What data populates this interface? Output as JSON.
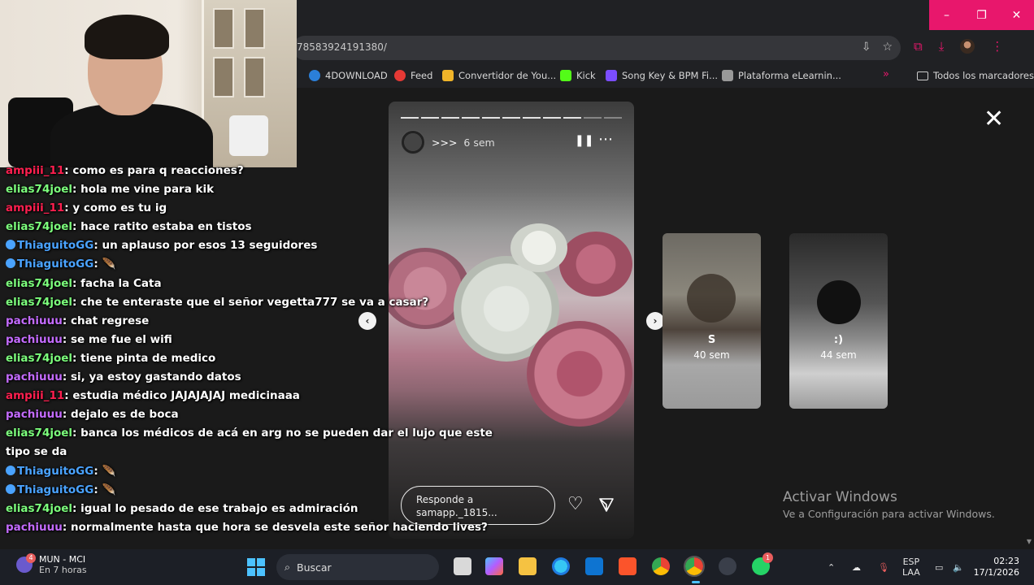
{
  "browser": {
    "url": "78583924191380/",
    "window_controls": {
      "minimize": "–",
      "maximize": "❐",
      "close": "✕"
    }
  },
  "bookmarks": [
    {
      "label": "4DOWNLOAD",
      "color": "#2b7fd9"
    },
    {
      "label": "Feed",
      "color": "#e53935"
    },
    {
      "label": "Convertidor de You...",
      "color": "#f0b429"
    },
    {
      "label": "Kick",
      "color": "#53fc18"
    },
    {
      "label": "Song Key & BPM Fi...",
      "color": "#7b4dff"
    },
    {
      "label": "Plataforma eLearnin...",
      "color": "#999999"
    }
  ],
  "bookmarks_overflow": "»",
  "bookmarks_all": "Todos los marcadores",
  "story": {
    "username": ">>>",
    "time": "6 sem",
    "pause_icon": "pause-icon",
    "more_icon": "⋯",
    "reply_placeholder": "Responde a samapp._1815...",
    "progress_segments": 11,
    "progress_viewed": 9
  },
  "side_stories": [
    {
      "initial": "S",
      "time": "40 sem"
    },
    {
      "initial": ":)",
      "time": "44 sem"
    }
  ],
  "close_label": "✕",
  "nav": {
    "prev": "‹",
    "next": "›"
  },
  "activate": {
    "title": "Activar Windows",
    "subtitle": "Ve a Configuración para activar Windows."
  },
  "chat": [
    {
      "user": "ampiii_11",
      "type": "ampiii",
      "msg": "como es para q reacciones?"
    },
    {
      "user": "elias74joel",
      "type": "elias",
      "msg": "hola me vine para kik"
    },
    {
      "user": "ampiii_11",
      "type": "ampiii",
      "msg": "y como es tu ig"
    },
    {
      "user": "elias74joel",
      "type": "elias",
      "msg": "hace ratito estaba en tistos"
    },
    {
      "user": "ThiaguitoGG",
      "type": "thiago",
      "msg": "un aplauso por esos 13 seguidores"
    },
    {
      "user": "ThiaguitoGG",
      "type": "thiago",
      "msg": "",
      "emote": true
    },
    {
      "user": "elias74joel",
      "type": "elias",
      "msg": "facha la Cata"
    },
    {
      "user": "elias74joel",
      "type": "elias",
      "msg": "che te enteraste que el señor vegetta777 se va a casar?"
    },
    {
      "user": "pachiuuu",
      "type": "pachi",
      "msg": "chat regrese"
    },
    {
      "user": "pachiuuu",
      "type": "pachi",
      "msg": "se me fue el wifi"
    },
    {
      "user": "elias74joel",
      "type": "elias",
      "msg": "tiene pinta de medico"
    },
    {
      "user": "pachiuuu",
      "type": "pachi",
      "msg": "si, ya estoy gastando datos"
    },
    {
      "user": "ampiii_11",
      "type": "ampiii",
      "msg": "estudia médico JAJAJAJAJ medicinaaa"
    },
    {
      "user": "pachiuuu",
      "type": "pachi",
      "msg": "dejalo es de boca"
    },
    {
      "user": "elias74joel",
      "type": "elias",
      "msg": "banca los médicos de acá en arg no se pueden dar el lujo que este"
    },
    {
      "user": "",
      "type": "cont",
      "msg": "tipo se da"
    },
    {
      "user": "ThiaguitoGG",
      "type": "thiago",
      "msg": "",
      "emote": true
    },
    {
      "user": "ThiaguitoGG",
      "type": "thiago",
      "msg": "",
      "emote": true
    },
    {
      "user": "elias74joel",
      "type": "elias",
      "msg": "igual lo pesado de ese trabajo es admiración"
    },
    {
      "user": "pachiuuu",
      "type": "pachi",
      "msg": "normalmente hasta que hora se desvela este señor haciendo lives?"
    }
  ],
  "taskbar": {
    "weather_title": "MUN - MCI",
    "weather_sub": "En 7 horas",
    "weather_badge": "4",
    "search_label": "Buscar",
    "lang_top": "ESP",
    "lang_bottom": "LAA",
    "time": "02:23",
    "date": "17/1/2026",
    "whatsapp_badge": "1"
  }
}
